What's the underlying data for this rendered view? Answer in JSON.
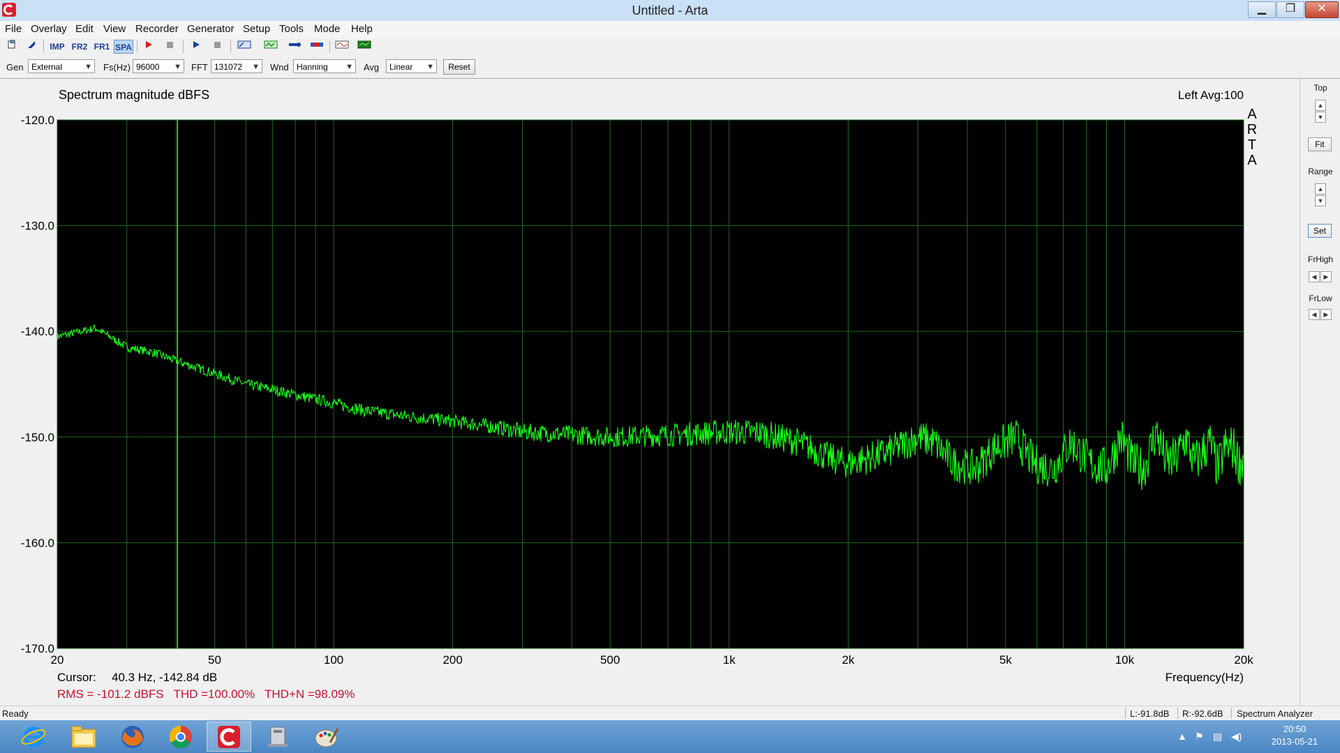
{
  "window": {
    "title": "Untitled - Arta"
  },
  "menu": [
    "File",
    "Overlay",
    "Edit",
    "View",
    "Recorder",
    "Generator",
    "Setup",
    "Tools",
    "Mode",
    "Help"
  ],
  "toolbar": {
    "imp": "IMP",
    "fr2": "FR2",
    "fr1": "FR1",
    "spa": "SPA"
  },
  "controls": {
    "gen_label": "Gen",
    "gen_value": "External",
    "fs_label": "Fs(Hz)",
    "fs_value": "96000",
    "fft_label": "FFT",
    "fft_value": "131072",
    "wnd_label": "Wnd",
    "wnd_value": "Hanning",
    "avg_label": "Avg",
    "avg_value": "Linear",
    "reset_label": "Reset"
  },
  "plot": {
    "title": "Spectrum magnitude dBFS",
    "channel_info": "Left  Avg:100",
    "watermark": [
      "A",
      "R",
      "T",
      "A"
    ],
    "y_ticks": [
      "-120.0",
      "-130.0",
      "-140.0",
      "-150.0",
      "-160.0",
      "-170.0"
    ],
    "x_ticks": [
      "20",
      "50",
      "100",
      "200",
      "500",
      "1k",
      "2k",
      "5k",
      "10k",
      "20k"
    ],
    "x_label": "Frequency(Hz)",
    "cursor_label": "Cursor:",
    "cursor_value": "40.3 Hz, -142.84 dB",
    "measurements": "RMS = -101.2 dBFS   THD =100.00%   THD+N =98.09%"
  },
  "right_panel": {
    "top": "Top",
    "fit": "Fit",
    "range": "Range",
    "set": "Set",
    "frhigh": "FrHigh",
    "frlow": "FrLow"
  },
  "status": {
    "ready": "Ready",
    "left_level": "L:-91.8dB",
    "right_level": "R:-92.6dB",
    "mode": "Spectrum Analyzer"
  },
  "clock": {
    "time": "20:50",
    "date": "2013-05-21"
  },
  "colors": {
    "plot_bg": "#000000",
    "grid": "#1f6b1f",
    "trace": "#18ff18",
    "cursor_line": "#c8c83c",
    "measure_text": "#c8102e"
  },
  "chart_data": {
    "type": "line",
    "title": "Spectrum magnitude dBFS",
    "xlabel": "Frequency(Hz)",
    "ylabel": "",
    "x_scale": "log",
    "xlim": [
      20,
      20000
    ],
    "ylim": [
      -170,
      -120
    ],
    "grid": true,
    "series": [
      {
        "x": [
          20,
          23,
          25,
          30,
          35,
          40,
          50,
          60,
          70,
          80,
          100,
          120,
          150,
          200,
          250,
          300,
          400,
          500,
          600,
          700,
          800,
          1000,
          1200,
          1500,
          1800,
          2000,
          2500,
          3000,
          3300,
          3700,
          4200,
          4700,
          5300,
          5900,
          6600,
          7300,
          8200,
          9000,
          9800,
          10500,
          11200,
          12000,
          12800,
          13500,
          14300,
          15000,
          15700,
          16400,
          17200,
          18000,
          18800,
          19500,
          20000
        ],
        "values": [
          -140.5,
          -140.0,
          -139.7,
          -141.5,
          -142.0,
          -142.8,
          -144.0,
          -145.0,
          -145.5,
          -146.0,
          -146.8,
          -147.5,
          -148.0,
          -148.5,
          -149.0,
          -149.5,
          -149.8,
          -150.0,
          -149.9,
          -149.8,
          -149.7,
          -149.5,
          -149.6,
          -150.5,
          -152.0,
          -152.5,
          -151.5,
          -150.0,
          -150.5,
          -152.5,
          -153.0,
          -151.0,
          -150.0,
          -152.5,
          -153.0,
          -150.5,
          -152.5,
          -153.0,
          -150.0,
          -152.5,
          -153.0,
          -149.5,
          -152.5,
          -152.0,
          -150.0,
          -152.5,
          -151.5,
          -150.5,
          -153.0,
          -151.0,
          -151.0,
          -152.5,
          -152.0
        ]
      }
    ]
  }
}
